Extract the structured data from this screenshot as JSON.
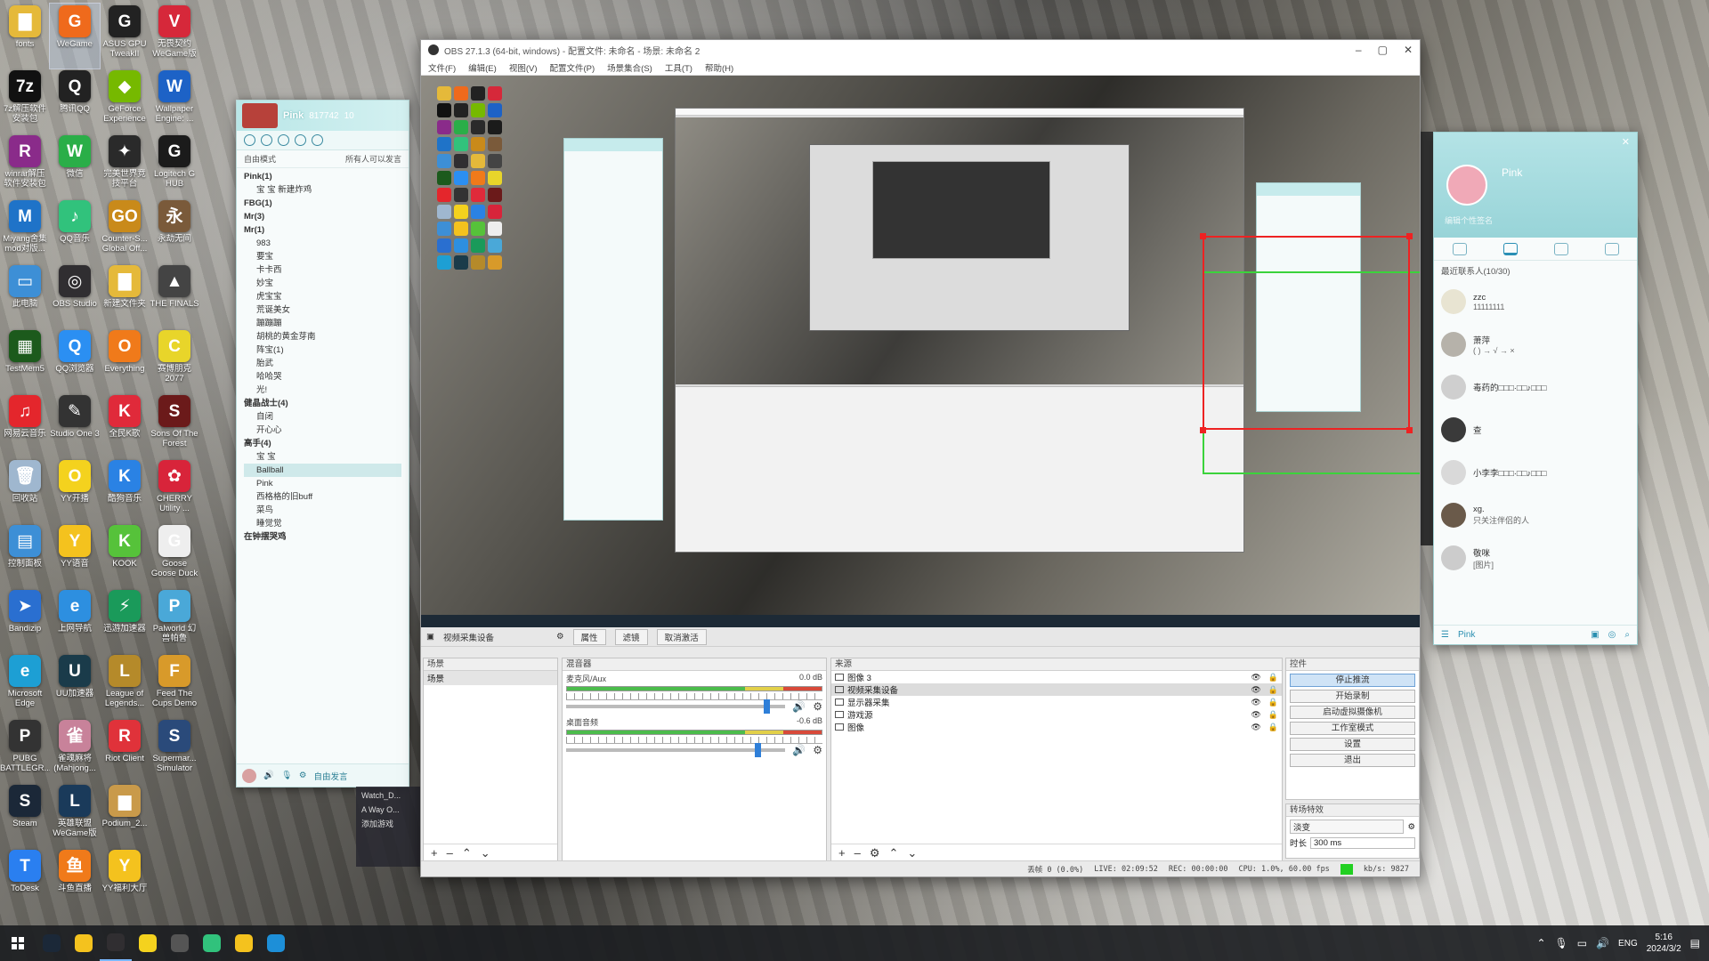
{
  "desktop": {
    "icons": [
      {
        "label": "fonts",
        "icon": "folder-icon",
        "color": "#e5b93a",
        "glyph": "▇"
      },
      {
        "label": "WeGame",
        "icon": "wegame-icon",
        "color": "#ef6a1c",
        "glyph": "G",
        "selected": true
      },
      {
        "label": "ASUS GPU TweakII",
        "icon": "asus-gpu-icon",
        "color": "#222222",
        "glyph": "G"
      },
      {
        "label": "无畏契约 WeGame版",
        "icon": "valorant-icon",
        "color": "#d6283a",
        "glyph": "V"
      },
      {
        "label": "7z解压软件 安装包",
        "icon": "7zip-icon",
        "color": "#111111",
        "glyph": "7z"
      },
      {
        "label": "腾讯QQ",
        "icon": "qq-icon",
        "color": "#222222",
        "glyph": "Q"
      },
      {
        "label": "GeForce Experience",
        "icon": "geforce-icon",
        "color": "#76b900",
        "glyph": "◆"
      },
      {
        "label": "Wallpaper Engine: ...",
        "icon": "wallpaper-engine-icon",
        "color": "#1d62c6",
        "glyph": "W"
      },
      {
        "label": "winrar解压 软件安装包",
        "icon": "winrar-icon",
        "color": "#8a2b8a",
        "glyph": "R"
      },
      {
        "label": "微信",
        "icon": "wechat-icon",
        "color": "#2aae48",
        "glyph": "W"
      },
      {
        "label": "完美世界竞 技平台",
        "icon": "perfect-world-icon",
        "color": "#2a2a2a",
        "glyph": "✦"
      },
      {
        "label": "Logitech G HUB",
        "icon": "logitech-icon",
        "color": "#1b1b1b",
        "glyph": "G"
      },
      {
        "label": "Miyang舍集 mod对版...",
        "icon": "miyang-icon",
        "color": "#1f73c8",
        "glyph": "M"
      },
      {
        "label": "QQ音乐",
        "icon": "qq-music-icon",
        "color": "#31c27c",
        "glyph": "♪"
      },
      {
        "label": "Counter-S... Global Off...",
        "icon": "csgo-icon",
        "color": "#c98a1a",
        "glyph": "GO"
      },
      {
        "label": "永劫无间",
        "icon": "naraka-icon",
        "color": "#7a5a3a",
        "glyph": "永"
      },
      {
        "label": "此电脑",
        "icon": "this-pc-icon",
        "color": "#3d8fd6",
        "glyph": "▭"
      },
      {
        "label": "OBS Studio",
        "icon": "obs-icon",
        "color": "#302e31",
        "glyph": "◎"
      },
      {
        "label": "新建文件夹",
        "icon": "folder-icon",
        "color": "#e5b93a",
        "glyph": "▇"
      },
      {
        "label": "THE FINALS",
        "icon": "the-finals-icon",
        "color": "#444444",
        "glyph": "▲"
      },
      {
        "label": "TestMem5",
        "icon": "testmem-icon",
        "color": "#1c5a1c",
        "glyph": "▦"
      },
      {
        "label": "QQ浏览器",
        "icon": "qq-browser-icon",
        "color": "#2b8ff2",
        "glyph": "Q"
      },
      {
        "label": "Everything",
        "icon": "everything-icon",
        "color": "#f07a1a",
        "glyph": "O"
      },
      {
        "label": "赛博朋克 2077",
        "icon": "cyberpunk-icon",
        "color": "#e8d52a",
        "glyph": "C"
      },
      {
        "label": "网易云音乐",
        "icon": "netease-music-icon",
        "color": "#e4262c",
        "glyph": "♫"
      },
      {
        "label": "Studio One 3",
        "icon": "studio-one-icon",
        "color": "#333333",
        "glyph": "✎"
      },
      {
        "label": "全民K歌",
        "icon": "kge-icon",
        "color": "#e02a3a",
        "glyph": "K"
      },
      {
        "label": "Sons Of The Forest",
        "icon": "sons-forest-icon",
        "color": "#6b1a1a",
        "glyph": "S"
      },
      {
        "label": "回收站",
        "icon": "recycle-bin-icon",
        "color": "#9fb7cf",
        "glyph": "🗑"
      },
      {
        "label": "YY开播",
        "icon": "yy-live-icon",
        "color": "#f4d21e",
        "glyph": "O"
      },
      {
        "label": "酷狗音乐",
        "icon": "kugou-icon",
        "color": "#2a82e4",
        "glyph": "K"
      },
      {
        "label": "CHERRY Utility ...",
        "icon": "cherry-icon",
        "color": "#d8243a",
        "glyph": "✿"
      },
      {
        "label": "控制面板",
        "icon": "control-panel-icon",
        "color": "#3d8fd6",
        "glyph": "▤"
      },
      {
        "label": "YY语音",
        "icon": "yy-voice-icon",
        "color": "#f4c21e",
        "glyph": "Y"
      },
      {
        "label": "KOOK",
        "icon": "kook-icon",
        "color": "#56c23a",
        "glyph": "K"
      },
      {
        "label": "Goose Goose Duck",
        "icon": "goose-duck-icon",
        "color": "#eeeeee",
        "glyph": "G"
      },
      {
        "label": "Bandizip",
        "icon": "bandizip-icon",
        "color": "#2a6fd0",
        "glyph": "➤"
      },
      {
        "label": "上网导航",
        "icon": "ie-icon",
        "color": "#2d8fe0",
        "glyph": "e"
      },
      {
        "label": "迅游加速器",
        "icon": "xunyou-icon",
        "color": "#1a9a5a",
        "glyph": "⚡"
      },
      {
        "label": "Palworld 幻兽帕鲁",
        "icon": "palworld-icon",
        "color": "#4aa8d8",
        "glyph": "P"
      },
      {
        "label": "Microsoft Edge",
        "icon": "edge-icon",
        "color": "#1d9fd4",
        "glyph": "e"
      },
      {
        "label": "UU加速器",
        "icon": "uu-icon",
        "color": "#1a3b4a",
        "glyph": "U"
      },
      {
        "label": "League of Legends...",
        "icon": "lol-icon",
        "color": "#b58a2a",
        "glyph": "L"
      },
      {
        "label": "Feed The Cups Demo",
        "icon": "feed-cups-icon",
        "color": "#d89a2a",
        "glyph": "F"
      },
      {
        "label": "PUBG BATTLEGR...",
        "icon": "pubg-icon",
        "color": "#333333",
        "glyph": "P"
      },
      {
        "label": "雀魂麻将 (Mahjong...",
        "icon": "mahjong-soul-icon",
        "color": "#c8829a",
        "glyph": "雀"
      },
      {
        "label": "Riot Client",
        "icon": "riot-icon",
        "color": "#e0323a",
        "glyph": "R"
      },
      {
        "label": "Supermar... Simulator",
        "icon": "supermarket-icon",
        "color": "#2a4a7a",
        "glyph": "S"
      },
      {
        "label": "Steam",
        "icon": "steam-icon",
        "color": "#1b2838",
        "glyph": "S"
      },
      {
        "label": "英雄联盟 WeGame版",
        "icon": "lol-wegame-icon",
        "color": "#1a3a5a",
        "glyph": "L"
      },
      {
        "label": "Podium_2...",
        "icon": "podium-icon",
        "color": "#c99a4a",
        "glyph": "▆"
      },
      {
        "label": "",
        "icon": "blank",
        "color": "transparent",
        "glyph": ""
      },
      {
        "label": "ToDesk",
        "icon": "todesk-icon",
        "color": "#2a7ff0",
        "glyph": "T"
      },
      {
        "label": "斗鱼直播",
        "icon": "douyu-icon",
        "color": "#f07a1a",
        "glyph": "鱼"
      },
      {
        "label": "YY福利大厅",
        "icon": "yy-welfare-icon",
        "color": "#f4c21e",
        "glyph": "Y"
      }
    ]
  },
  "qq_left": {
    "name": "Pink",
    "stat_count": "817742",
    "stat_online": "10",
    "mode": "自由模式",
    "permission": "所有人可以发言",
    "rows": [
      {
        "text": "Pink(1)",
        "type": "grp"
      },
      {
        "text": "宝 宝 新建炸鸡",
        "type": "sub"
      },
      {
        "text": "FBG(1)",
        "type": "grp"
      },
      {
        "text": "Mr(3)",
        "type": "grp"
      },
      {
        "text": "Mr(1)",
        "type": "grp"
      },
      {
        "text": "983",
        "type": "sub"
      },
      {
        "text": "要宝",
        "type": "sub"
      },
      {
        "text": "卡卡西",
        "type": "sub"
      },
      {
        "text": "妙宝",
        "type": "sub"
      },
      {
        "text": "虎宝宝",
        "type": "sub"
      },
      {
        "text": "荒诞美女",
        "type": "sub"
      },
      {
        "text": "蹦蹦蹦",
        "type": "sub"
      },
      {
        "text": "胡桃的黄金芽南",
        "type": "sub"
      },
      {
        "text": "阵宝(1)",
        "type": "sub"
      },
      {
        "text": "胎武",
        "type": "sub"
      },
      {
        "text": "哈哈哭",
        "type": "sub"
      },
      {
        "text": "光!",
        "type": "sub"
      },
      {
        "text": "健晶战士(4)",
        "type": "grp"
      },
      {
        "text": "自闭",
        "type": "sub"
      },
      {
        "text": "开心心",
        "type": "sub"
      },
      {
        "text": "高手(4)",
        "type": "grp"
      },
      {
        "text": "宝 宝",
        "type": "sub"
      },
      {
        "text": "Ballball",
        "type": "sub",
        "hl": true
      },
      {
        "text": "Pink",
        "type": "sub"
      },
      {
        "text": "西格格的旧buff",
        "type": "sub"
      },
      {
        "text": "菜鸟",
        "type": "sub"
      },
      {
        "text": "睡觉觉",
        "type": "sub"
      },
      {
        "text": "在钟摆哭鸡",
        "type": "grp"
      }
    ],
    "footer_label": "自由发言"
  },
  "game_list": {
    "items": [
      "Watch_D...",
      "A Way O...",
      "添加游戏"
    ]
  },
  "obs": {
    "title": "OBS 27.1.3 (64-bit, windows) - 配置文件: 未命名 - 场景: 未命名 2",
    "menu": [
      "文件(F)",
      "编辑(E)",
      "视图(V)",
      "配置文件(P)",
      "场景集合(S)",
      "工具(T)",
      "帮助(H)"
    ],
    "toolbar": {
      "source_label": "视频采集设备",
      "properties": "属性",
      "filters": "滤镜",
      "deactivate": "取消激活"
    },
    "scenes": {
      "header": "场景",
      "items": [
        "场景"
      ]
    },
    "mixer": {
      "header": "混音器",
      "tracks": [
        {
          "name": "麦克风/Aux",
          "db": "0.0 dB",
          "level": 0.9
        },
        {
          "name": "桌面音频",
          "db": "-0.6 dB",
          "level": 0.86
        }
      ]
    },
    "sources": {
      "header": "来源",
      "items": [
        {
          "name": "图像 3",
          "selected": false
        },
        {
          "name": "视频采集设备",
          "selected": true
        },
        {
          "name": "显示器采集",
          "selected": false
        },
        {
          "name": "游戏源",
          "selected": false
        },
        {
          "name": "图像",
          "selected": false
        }
      ]
    },
    "controls": {
      "header": "控件",
      "buttons": [
        {
          "label": "停止推流",
          "active": true
        },
        {
          "label": "开始录制",
          "active": false
        },
        {
          "label": "启动虚拟摄像机",
          "active": false
        },
        {
          "label": "工作室模式",
          "active": false
        },
        {
          "label": "设置",
          "active": false
        },
        {
          "label": "退出",
          "active": false
        }
      ]
    },
    "transitions": {
      "header": "转场特效",
      "type": "淡变",
      "duration_label": "时长",
      "duration_value": "300 ms"
    },
    "status": {
      "dropped": "丢帧 0 (0.0%)",
      "live": "LIVE: 02:09:52",
      "rec": "REC: 00:00:00",
      "cpu": "CPU: 1.0%, 60.00 fps",
      "bitrate": "kb/s: 9827"
    }
  },
  "qq_right": {
    "name": "Pink",
    "signature": "编辑个性签名",
    "recent_label": "最近联系人(10/30)",
    "contacts": [
      {
        "name": "zzc",
        "msg": "11111111",
        "avatar": "#e8e4d2"
      },
      {
        "name": "萧萍",
        "msg": "( ) → √ → ×",
        "avatar": "#b6b2aa"
      },
      {
        "name": "毒药的□□□·□□♪□□□",
        "msg": "",
        "avatar": "#cfcfcf"
      },
      {
        "name": "查",
        "msg": "",
        "avatar": "#3a3a3a"
      },
      {
        "name": "小李李□□□·□□♪□□□",
        "msg": "",
        "avatar": "#d9d9d9"
      },
      {
        "name": "xg.",
        "msg": "只关注伴侣的人",
        "avatar": "#6a5a4a"
      },
      {
        "name": "敬咪",
        "msg": "[图片]",
        "avatar": "#cccccc"
      }
    ],
    "footer_label": "Pink"
  },
  "taskbar": {
    "apps": [
      {
        "icon": "steam-taskbar-icon",
        "color": "#1b2838"
      },
      {
        "icon": "yy-taskbar-icon",
        "color": "#f4c21e"
      },
      {
        "icon": "obs-taskbar-icon",
        "color": "#302e31",
        "active": true
      },
      {
        "icon": "yy-live-taskbar-icon",
        "color": "#f4d21e"
      },
      {
        "icon": "studio-one-taskbar-icon",
        "color": "#555555"
      },
      {
        "icon": "qq-music-taskbar-icon",
        "color": "#31c27c"
      },
      {
        "icon": "yy-voice-taskbar-icon",
        "color": "#f4c21e"
      },
      {
        "icon": "wallpaper-taskbar-icon",
        "color": "#1d8fd8"
      }
    ],
    "lang": "ENG",
    "time": "5:16",
    "date": "2024/3/2"
  }
}
